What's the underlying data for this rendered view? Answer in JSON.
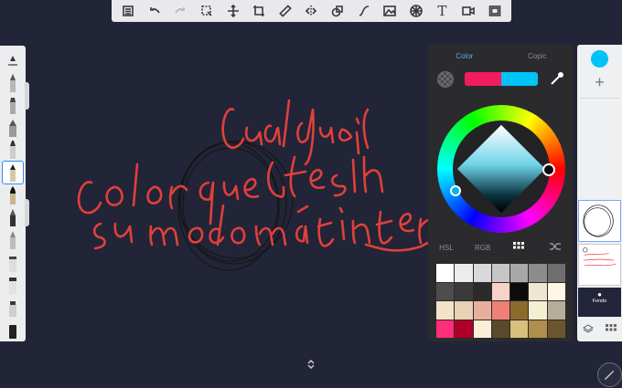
{
  "toolbar": {
    "icons": [
      "gallery-icon",
      "undo-icon",
      "redo-icon",
      "select-icon",
      "transform-icon",
      "crop-icon",
      "ruler-icon",
      "symmetry-icon",
      "shape-icon",
      "stroke-icon",
      "image-icon",
      "perspective-icon",
      "text-icon",
      "video-icon",
      "fullscreen-icon"
    ],
    "text_tool_label": "T"
  },
  "brushes": {
    "selected_index": 6,
    "count": 13
  },
  "color_panel": {
    "tab_color": "Color",
    "tab_copic": "Copic",
    "current_color": "#00c3f5",
    "previous_color": "#f01c5e",
    "modes": [
      "HSL",
      "RGB",
      "grid",
      "shuffle"
    ],
    "palette": [
      "#ffffff",
      "#ececec",
      "#d9d9d9",
      "#c6c6c6",
      "#a8a8a8",
      "#8c8c8c",
      "#6e6e6e",
      "#4d4d4d",
      "#3a3a3a",
      "#2b2b2b",
      "#f6d3c7",
      "#0c0c0c",
      "#f0e6d0",
      "#fff6e5",
      "#f2e3c8",
      "#e7d2b3",
      "#e8b09a",
      "#f07f76",
      "#8b6a2c",
      "#f4efd0",
      "#b5ad9a",
      "#ff2d7a",
      "#b0002a",
      "#fbefd8",
      "#5a4a2a",
      "#d9bf7c",
      "#b28e4c",
      "#6b5630"
    ]
  },
  "layers": {
    "background_label": "Fondo",
    "current_color": "#00c3f5"
  },
  "sketch": {
    "line1": "Cualquier",
    "line2": "color que gustes en",
    "line3": "su modo más interno!"
  }
}
